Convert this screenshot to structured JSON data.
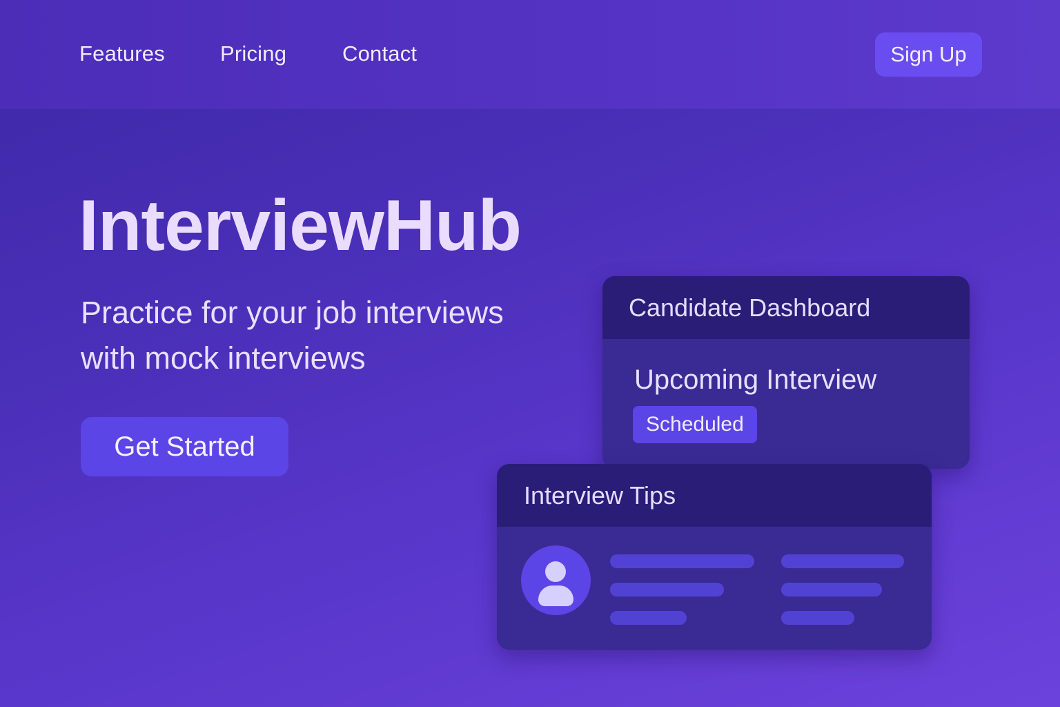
{
  "nav": {
    "links": [
      "Features",
      "Pricing",
      "Contact"
    ],
    "signup_label": "Sign Up"
  },
  "hero": {
    "title": "InterviewHub",
    "subtitle": "Practice for your job interviews with mock interviews",
    "cta_label": "Get Started"
  },
  "dashboard_card": {
    "title": "Candidate Dashboard",
    "heading": "Upcoming Interview",
    "status": "Scheduled"
  },
  "tips_card": {
    "title": "Interview Tips",
    "avatar_icon": "user-icon"
  },
  "colors": {
    "accent": "#5b45e6",
    "signup": "#6a4df0",
    "card_header": "#2a1d78",
    "card_body": "#3a2a94"
  }
}
